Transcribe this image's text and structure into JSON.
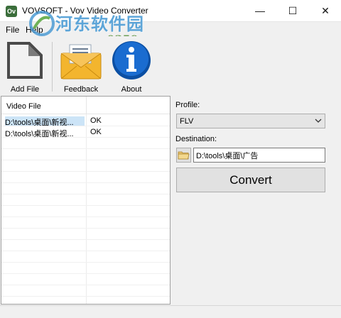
{
  "window": {
    "title": "VOVSOFT - Vov Video Converter",
    "min_glyph": "—",
    "max_glyph": "☐",
    "close_glyph": "✕",
    "app_icon_text": "Ov"
  },
  "watermark": {
    "text_cn": "河东软件园",
    "url": "www.pc0359.cn"
  },
  "menu": {
    "file": "File",
    "help": "Help"
  },
  "toolbar": {
    "add_file": "Add File",
    "feedback": "Feedback",
    "about": "About"
  },
  "list": {
    "column_header": "Video File",
    "rows": [
      {
        "file": "D:\\tools\\桌面\\新视...",
        "status": "OK"
      },
      {
        "file": "D:\\tools\\桌面\\新视...",
        "status": "OK"
      }
    ]
  },
  "settings": {
    "profile_label": "Profile:",
    "profile_value": "FLV",
    "destination_label": "Destination:",
    "destination_value": "D:\\tools\\桌面\\广告",
    "convert_label": "Convert"
  },
  "colors": {
    "selection": "#cce4f7",
    "about_icon": "#1560b8",
    "feedback_envelope": "#f0b430"
  }
}
